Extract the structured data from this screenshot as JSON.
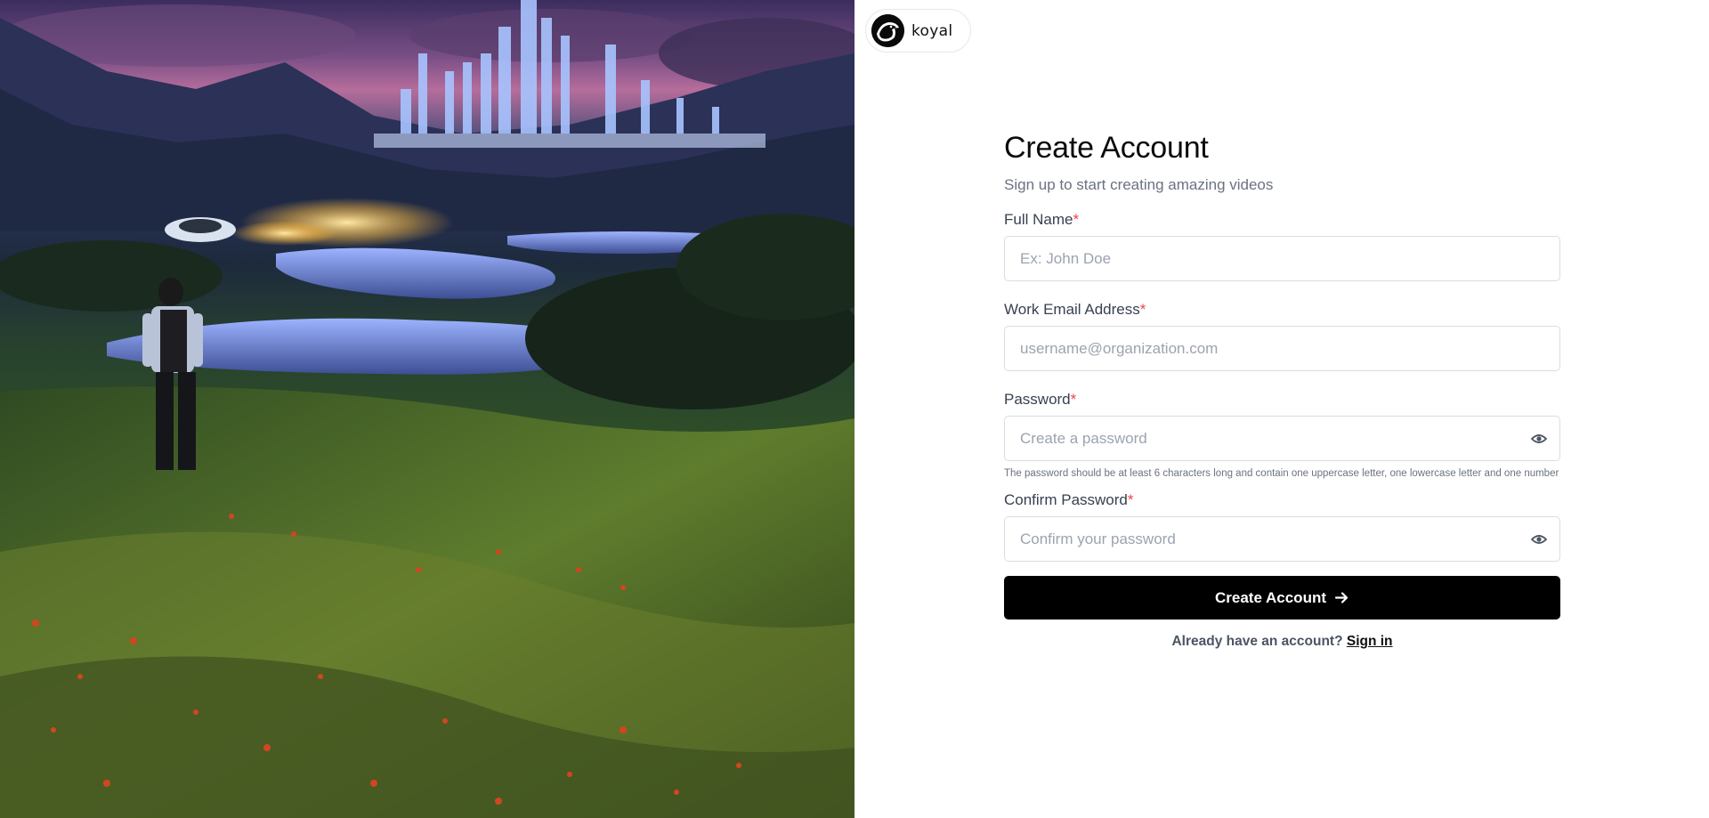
{
  "brand": {
    "name": "koyal",
    "logo_icon": "crow-logo-icon"
  },
  "page": {
    "title": "Create Account",
    "subtitle": "Sign up to start creating amazing videos"
  },
  "form": {
    "full_name": {
      "label": "Full Name",
      "required_mark": "*",
      "placeholder": "Ex: John Doe",
      "value": ""
    },
    "email": {
      "label": "Work Email Address",
      "required_mark": "*",
      "placeholder": "username@organization.com",
      "value": ""
    },
    "password": {
      "label": "Password",
      "required_mark": "*",
      "placeholder": "Create a password",
      "value": "",
      "toggle_icon": "eye-icon"
    },
    "password_hint": "The password should be at least 6 characters long and contain one uppercase letter, one lowercase letter and one number",
    "confirm_password": {
      "label": "Confirm Password",
      "required_mark": "*",
      "placeholder": "Confirm your password",
      "value": "",
      "toggle_icon": "eye-icon"
    },
    "submit_label": "Create Account",
    "submit_icon": "arrow-right-icon",
    "signin_prompt": "Already have an account?",
    "signin_link": "Sign in"
  },
  "colors": {
    "accent": "#000000",
    "required": "#ef4444",
    "muted_text": "#6b7280",
    "border": "#d9dde3"
  }
}
